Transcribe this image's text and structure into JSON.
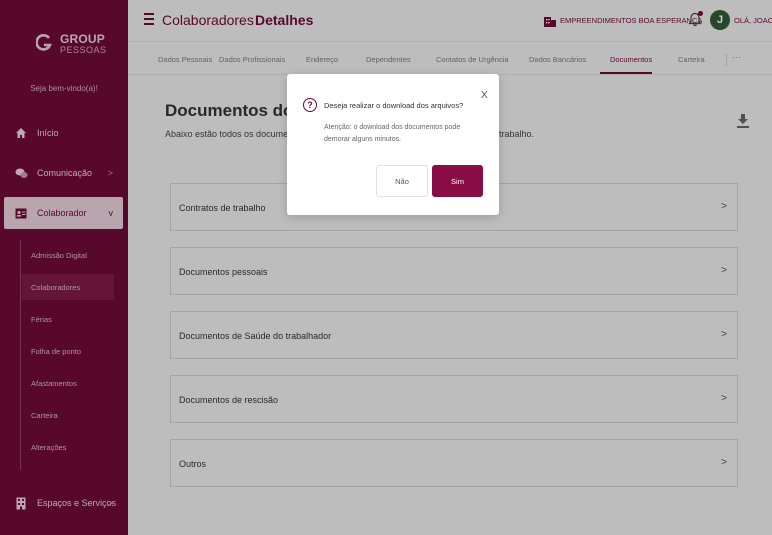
{
  "sidebar": {
    "logo_group": "GROUP",
    "logo_sub": "PESSOAS",
    "welcome": "Seja bem-vindo(a)!",
    "items": [
      {
        "label": "Início",
        "icon": "home-icon"
      },
      {
        "label": "Comunicação",
        "icon": "chat-icon"
      },
      {
        "label": "Colaborador",
        "icon": "id-card-icon"
      },
      {
        "label": "Espaços e Serviços",
        "icon": "building-icon"
      }
    ],
    "subitems": [
      "Admissão Digital",
      "Colaboradores",
      "Férias",
      "Folha de ponto",
      "Afastamentos",
      "Carteira",
      "Alterações"
    ],
    "active_subitem": "Colaboradores"
  },
  "header": {
    "crumb1": "Colaboradores",
    "crumb_sep": "›",
    "crumb2": "Detalhes",
    "company": "EMPREENDIMENTOS BOA ESPERANÇA",
    "avatar_initial": "J",
    "greeting": "OLÁ, JOAO"
  },
  "tabs": [
    "Dados Pessoais",
    "Dados Profissionais",
    "Endereço",
    "Dependentes",
    "Contatos de Urgência",
    "Dados Bancários",
    "Documentos",
    "Carteira"
  ],
  "active_tab": "Documentos",
  "main": {
    "title": "Documentos do colaborador",
    "subtitle_left": "Abaixo estão todos os documentos",
    "subtitle_right": "trabalho.",
    "categories": [
      "Contratos de trabalho",
      "Documentos pessoais",
      "Documentos de Saúde do trabalhador",
      "Documentos de rescisão",
      "Outros"
    ]
  },
  "modal": {
    "title": "Deseja realizar o download dos arquivos?",
    "message": "Atenção: o download dos documentos pode demorar alguns minutos.",
    "close": "X",
    "no_label": "Não",
    "yes_label": "Sim"
  },
  "colors": {
    "brand": "#6e0a35",
    "button": "#8a0c44"
  }
}
